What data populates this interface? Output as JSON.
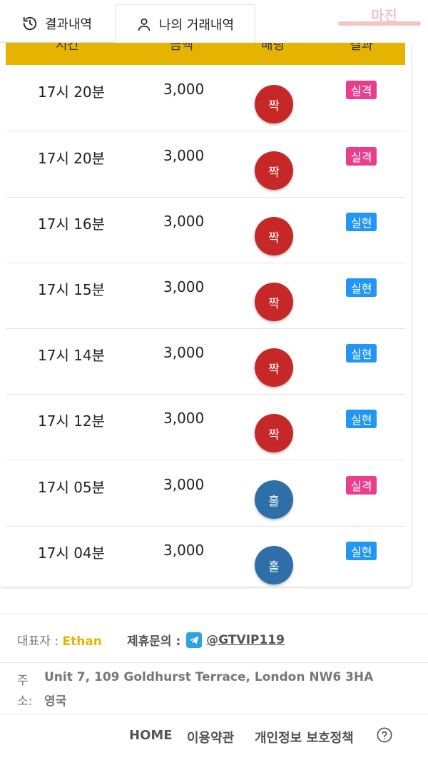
{
  "tabs": [
    {
      "label": "결과내역",
      "icon": "history-icon"
    },
    {
      "label": "나의 거래내역",
      "icon": "user-icon"
    }
  ],
  "logo": {
    "text": "마진"
  },
  "table": {
    "headers": [
      "시간",
      "금액",
      "배팅",
      "결과"
    ],
    "rows": [
      {
        "time": "17시 20분",
        "amount": "3,000",
        "bet": "짝",
        "result": "실격"
      },
      {
        "time": "17시 20분",
        "amount": "3,000",
        "bet": "짝",
        "result": "실격"
      },
      {
        "time": "17시 16분",
        "amount": "3,000",
        "bet": "짝",
        "result": "실현"
      },
      {
        "time": "17시 15분",
        "amount": "3,000",
        "bet": "짝",
        "result": "실현"
      },
      {
        "time": "17시 14분",
        "amount": "3,000",
        "bet": "짝",
        "result": "실현"
      },
      {
        "time": "17시 12분",
        "amount": "3,000",
        "bet": "짝",
        "result": "실현"
      },
      {
        "time": "17시 05분",
        "amount": "3,000",
        "bet": "홀",
        "result": "실격"
      },
      {
        "time": "17시 04분",
        "amount": "3,000",
        "bet": "홀",
        "result": "실현"
      }
    ]
  },
  "colors": {
    "header_bar": "#e6b400",
    "even_ball": "#c62828",
    "odd_ball": "#2f6fa8",
    "fail_badge": "#e83e8c",
    "success_badge": "#2196f3"
  },
  "footer": {
    "rep_label": "대표자 : ",
    "rep_name": "Ethan",
    "contact_label": "제휴문의 :",
    "contact_handle": "@GTVIP119",
    "addr_label_1": "주",
    "addr_label_2": "소:",
    "addr_line_1": "Unit 7, 109 Goldhurst Terrace, London NW6 3HA",
    "addr_line_2": "영국",
    "links": [
      "HOME",
      "이용약관",
      "개인정보 보호정책"
    ]
  }
}
